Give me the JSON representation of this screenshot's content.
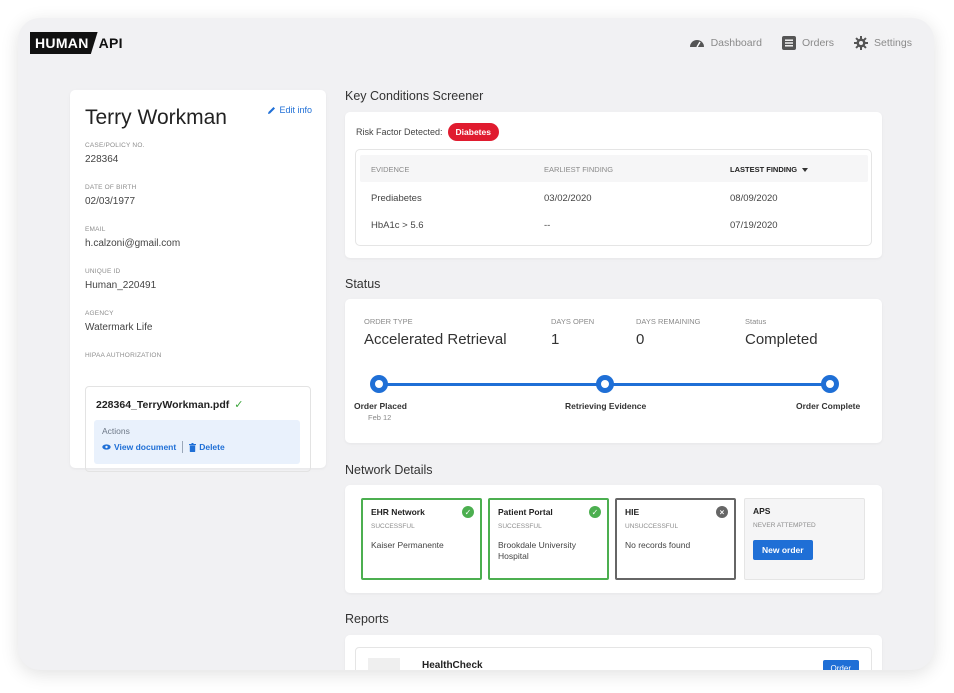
{
  "logo": {
    "part1": "HUMAN",
    "part2": "API"
  },
  "nav": {
    "dashboard": "Dashboard",
    "orders": "Orders",
    "settings": "Settings"
  },
  "profile": {
    "name": "Terry Workman",
    "edit_label": "Edit info",
    "fields": {
      "case_label": "CASE/POLICY NO.",
      "case_value": "228364",
      "dob_label": "DATE OF BIRTH",
      "dob_value": "02/03/1977",
      "email_label": "EMAIL",
      "email_value": "h.calzoni@gmail.com",
      "uid_label": "UNIQUE ID",
      "uid_value": "Human_220491",
      "agency_label": "AGENCY",
      "agency_value": "Watermark Life",
      "hipaa_label": "HIPAA AUTHORIZATION"
    },
    "hipaa_file": "228364_TerryWorkman.pdf",
    "actions_title": "Actions",
    "view_document": "View document",
    "delete": "Delete"
  },
  "key_conditions": {
    "title": "Key Conditions Screener",
    "risk_label": "Risk Factor Detected:",
    "risk_badge": "Diabetes",
    "columns": [
      "EVIDENCE",
      "EARLIEST FINDING",
      "LASTEST FINDING"
    ],
    "rows": [
      {
        "evidence": "Prediabetes",
        "earliest": "03/02/2020",
        "latest": "08/09/2020"
      },
      {
        "evidence": "HbA1c > 5.6",
        "earliest": "--",
        "latest": "07/19/2020"
      }
    ]
  },
  "status": {
    "title": "Status",
    "order_type_label": "ORDER TYPE",
    "order_type_value": "Accelerated Retrieval",
    "days_open_label": "DAYS OPEN",
    "days_open_value": "1",
    "days_remaining_label": "DAYS REMAINING",
    "days_remaining_value": "0",
    "status_label": "Status",
    "status_value": "Completed",
    "steps": [
      {
        "label": "Order Placed",
        "date": "Feb 12"
      },
      {
        "label": "Retrieving Evidence"
      },
      {
        "label": "Order Complete"
      }
    ]
  },
  "network": {
    "title": "Network Details",
    "items": [
      {
        "name": "EHR Network",
        "status": "SUCCESSFUL",
        "detail": "Kaiser Permanente"
      },
      {
        "name": "Patient Portal",
        "status": "SUCCESSFUL",
        "detail": "Brookdale University Hospital"
      },
      {
        "name": "HIE",
        "status": "UNSUCCESSFUL",
        "detail": "No records found"
      },
      {
        "name": "APS",
        "status": "NEVER ATTEMPTED",
        "button": "New order"
      }
    ],
    "colors": {
      "success": "#4caf50",
      "fail": "#666666",
      "accent": "#1f6fd6"
    }
  },
  "reports": {
    "title": "Reports",
    "item_title": "HealthCheck",
    "item_button": "Order"
  }
}
